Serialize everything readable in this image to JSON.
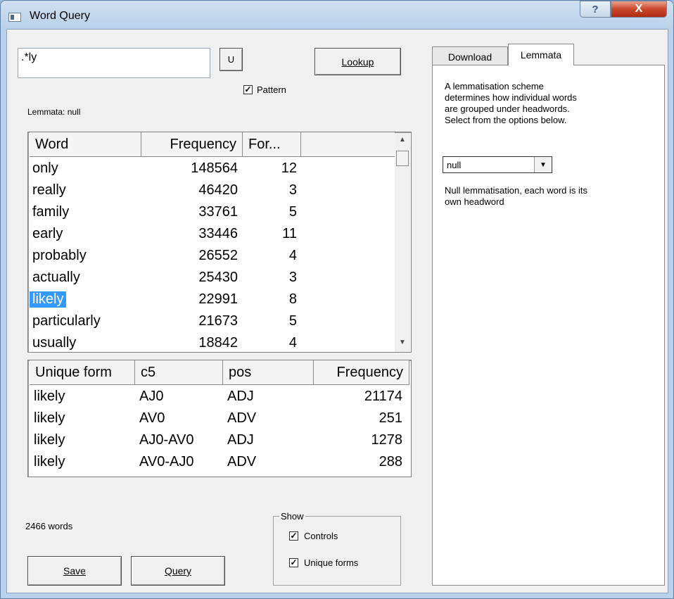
{
  "window": {
    "title": "Word Query",
    "help_glyph": "?",
    "close_glyph": "X"
  },
  "query": {
    "pattern_value": ".*ly",
    "u_button": "U",
    "lookup_button": "Lookup",
    "pattern_checkbox": {
      "label": "Pattern",
      "checked": true
    },
    "lemmata_label": "Lemmata: null"
  },
  "word_table": {
    "columns": [
      "Word",
      "Frequency",
      "For..."
    ],
    "rows": [
      {
        "word": "only",
        "frequency": "148564",
        "forms": "12"
      },
      {
        "word": "really",
        "frequency": "46420",
        "forms": "3"
      },
      {
        "word": "family",
        "frequency": "33761",
        "forms": "5"
      },
      {
        "word": "early",
        "frequency": "33446",
        "forms": "11"
      },
      {
        "word": "probably",
        "frequency": "26552",
        "forms": "4"
      },
      {
        "word": "actually",
        "frequency": "25430",
        "forms": "3"
      },
      {
        "word": "likely",
        "frequency": "22991",
        "forms": "8",
        "selected": true
      },
      {
        "word": "particularly",
        "frequency": "21673",
        "forms": "5"
      },
      {
        "word": "usually",
        "frequency": "18842",
        "forms": "4"
      }
    ]
  },
  "forms_table": {
    "columns": [
      "Unique form",
      "c5",
      "pos",
      "Frequency"
    ],
    "rows": [
      {
        "form": "likely",
        "c5": "AJ0",
        "pos": "ADJ",
        "frequency": "21174"
      },
      {
        "form": "likely",
        "c5": "AV0",
        "pos": "ADV",
        "frequency": "251"
      },
      {
        "form": "likely",
        "c5": "AJ0-AV0",
        "pos": "ADJ",
        "frequency": "1278"
      },
      {
        "form": "likely",
        "c5": "AV0-AJ0",
        "pos": "ADV",
        "frequency": "288"
      }
    ]
  },
  "footer": {
    "word_count": "2466 words",
    "save_button": "Save",
    "query_button": "Query",
    "show_group": {
      "legend": "Show",
      "controls": {
        "label": "Controls",
        "checked": true
      },
      "unique_forms": {
        "label": "Unique forms",
        "checked": true
      }
    }
  },
  "side_panel": {
    "tabs": [
      {
        "label": "Download",
        "active": false
      },
      {
        "label": "Lemmata",
        "active": true
      }
    ],
    "description_lines": [
      "A lemmatisation scheme",
      "determines how individual words",
      "are grouped under headwords.",
      "Select from the options below."
    ],
    "scheme_select": "null",
    "scheme_note_lines": [
      "Null lemmatisation, each word is its",
      "own headword"
    ]
  },
  "colors": {
    "selection": "#3399ff",
    "close_button": "#c9472c",
    "frame": "#b9d1ea"
  },
  "icons": [
    "app-icon",
    "help-icon",
    "close-icon",
    "checkbox-check-icon",
    "dropdown-arrow-icon",
    "scroll-up-icon",
    "scroll-down-icon"
  ]
}
